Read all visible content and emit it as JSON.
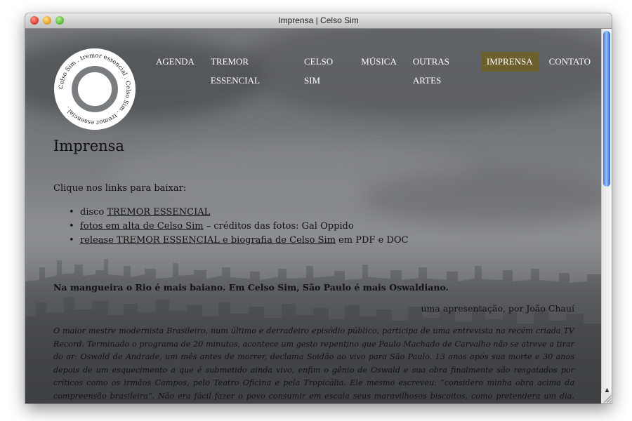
{
  "window": {
    "title": "Imprensa | Celso Sim"
  },
  "logo": {
    "ring_text": "Celso Sim . tremor essencial . Celso Sim . tremor essencial ."
  },
  "nav": [
    {
      "label": "AGENDA",
      "active": false
    },
    {
      "label": "TREMOR ESSENCIAL",
      "active": false
    },
    {
      "label": "CELSO SIM",
      "active": false
    },
    {
      "label": "MÚSICA",
      "active": false
    },
    {
      "label": "OUTRAS ARTES",
      "active": false
    },
    {
      "label": "IMPRENSA",
      "active": true
    },
    {
      "label": "CONTATO",
      "active": false
    }
  ],
  "page": {
    "title": "Imprensa",
    "intro": "Clique nos links para baixar:",
    "links": [
      {
        "prefix": "disco ",
        "link": "TREMOR ESSENCIAL",
        "suffix": ""
      },
      {
        "prefix": "",
        "link": "fotos em alta de Celso Sim",
        "suffix": " – créditos das fotos: Gal Oppido"
      },
      {
        "prefix": "",
        "link": "release TREMOR ESSENCIAL e biografia de Celso Sim",
        "suffix": " em PDF e DOC"
      }
    ],
    "headline": "Na mangueira o Rio é mais baiano.  Em Celso Sim, São Paulo é mais Oswaldiano.",
    "byline": "uma apresentação, por João Chauí",
    "body": "O  maior mestre modernista Brasileiro, num último e derradeiro episódio público, participa de uma entrevista na recém criada TV Record. Terminado o programa de 20 minutos, acontece um gesto repentino que Paulo Machado de Carvalho não se atreve a tirar do ar: Oswald de Andrade, um mês antes de morrer, declama Soidão ao vivo para São Paulo. 13 anos após sua morte e 30 anos depois de um esquecimento a que é submetido ainda vivo, enfim o gênio de Oswald e sua obra finalmente são resgatados por críticos como os irmãos Campos, pelo Teatro Oficina e pela Tropicália. Ele mesmo escreveu: “considero minha obra acima da compreensão brasileira”. Não era fácil fazer o povo consumir em escala seus maravilhosos biscoitos, como pretendera um dia. Desde então, a música brasileira moderna tem se servido dessa produção, mesmo que muitas vezes a obra de Oswald de Andrade permaneça soterrada sob a superficialidade a que muitas vezes é submetido o conceito de antropofagia, neutralizando-o, deixando a sua obra mais uma vez acima da compreensão"
  },
  "colors": {
    "nav_active_bg": "#6e5f2e",
    "text": "#111111"
  },
  "icons": [
    "close-window-icon",
    "minimize-window-icon",
    "zoom-window-icon",
    "scroll-up-arrow-icon",
    "scroll-down-arrow-icon",
    "resize-grip-icon"
  ]
}
